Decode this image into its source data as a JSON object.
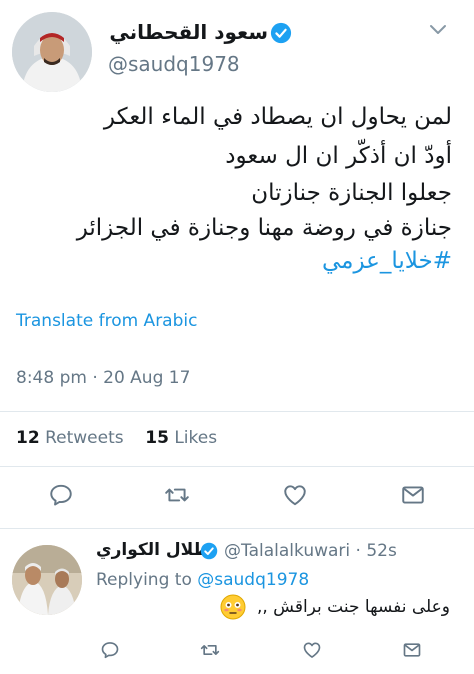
{
  "tweet": {
    "author_name": "سعود القحطاني",
    "handle": "@saudq1978",
    "lines": [
      "لمن يحاول ان يصطاد في الماء العكر",
      "أودّ ان أذكّر ان ال سعود",
      "جعلوا الجنازة جنازتان",
      "جنازة في روضة مهنا وجنازة في الجزائر"
    ],
    "hashtag": "#خلايا_عزمي",
    "translate_label": "Translate from Arabic",
    "timestamp": "8:48 pm · 20 Aug 17",
    "retweets_count": "12",
    "retweets_label": "Retweets",
    "likes_count": "15",
    "likes_label": "Likes"
  },
  "reply": {
    "author_name": "طلال الكواري",
    "handle": "@Talalalkuwari",
    "time": "52s",
    "replying_prefix": "Replying to",
    "replying_to": "@saudq1978",
    "text": "وعلى نفسها جنت براقش ,,"
  },
  "colors": {
    "link": "#1b95e0",
    "secondary": "#657786",
    "verified": "#1da1f2"
  }
}
